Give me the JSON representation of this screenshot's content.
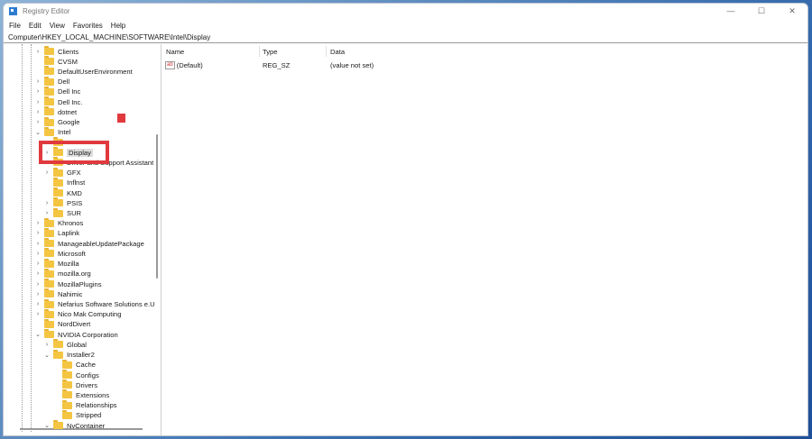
{
  "window": {
    "title": "Registry Editor",
    "controls": [
      "—",
      "☐",
      "✕"
    ]
  },
  "menu": [
    "File",
    "Edit",
    "View",
    "Favorites",
    "Help"
  ],
  "address": "Computer\\HKEY_LOCAL_MACHINE\\SOFTWARE\\Intel\\Display",
  "tree": [
    {
      "label": "Clients",
      "level": 1,
      "exp": ">"
    },
    {
      "label": "CVSM",
      "level": 1,
      "exp": ""
    },
    {
      "label": "DefaultUserEnvironment",
      "level": 1,
      "exp": ""
    },
    {
      "label": "Dell",
      "level": 1,
      "exp": ">"
    },
    {
      "label": "Dell Inc",
      "level": 1,
      "exp": ">"
    },
    {
      "label": "Dell Inc.",
      "level": 1,
      "exp": ">"
    },
    {
      "label": "dotnet",
      "level": 1,
      "exp": ">"
    },
    {
      "label": "Google",
      "level": 1,
      "exp": ">"
    },
    {
      "label": "Intel",
      "level": 1,
      "exp": "v"
    },
    {
      "label": "",
      "level": 2,
      "exp": ""
    },
    {
      "label": "Display",
      "level": 2,
      "exp": ">",
      "selected": true
    },
    {
      "label": "Driver and Support Assistant",
      "level": 2,
      "exp": ">"
    },
    {
      "label": "GFX",
      "level": 2,
      "exp": ">"
    },
    {
      "label": "Inflnst",
      "level": 2,
      "exp": ""
    },
    {
      "label": "KMD",
      "level": 2,
      "exp": ""
    },
    {
      "label": "PSIS",
      "level": 2,
      "exp": ">"
    },
    {
      "label": "SUR",
      "level": 2,
      "exp": ">"
    },
    {
      "label": "Khronos",
      "level": 1,
      "exp": ">"
    },
    {
      "label": "Laplink",
      "level": 1,
      "exp": ">"
    },
    {
      "label": "ManageableUpdatePackage",
      "level": 1,
      "exp": ">"
    },
    {
      "label": "Microsoft",
      "level": 1,
      "exp": ">"
    },
    {
      "label": "Mozilla",
      "level": 1,
      "exp": ">"
    },
    {
      "label": "mozilla.org",
      "level": 1,
      "exp": ">"
    },
    {
      "label": "MozillaPlugins",
      "level": 1,
      "exp": ">"
    },
    {
      "label": "Nahimic",
      "level": 1,
      "exp": ">"
    },
    {
      "label": "Nefarius Software Solutions e.U",
      "level": 1,
      "exp": ">"
    },
    {
      "label": "Nico Mak Computing",
      "level": 1,
      "exp": ">"
    },
    {
      "label": "NordDivert",
      "level": 1,
      "exp": ""
    },
    {
      "label": "NVIDIA Corporation",
      "level": 1,
      "exp": "v"
    },
    {
      "label": "Global",
      "level": 2,
      "exp": ">"
    },
    {
      "label": "Installer2",
      "level": 2,
      "exp": "v"
    },
    {
      "label": "Cache",
      "level": 3,
      "exp": ""
    },
    {
      "label": "Configs",
      "level": 3,
      "exp": ""
    },
    {
      "label": "Drivers",
      "level": 3,
      "exp": ""
    },
    {
      "label": "Extensions",
      "level": 3,
      "exp": ""
    },
    {
      "label": "Relationships",
      "level": 3,
      "exp": ""
    },
    {
      "label": "Stripped",
      "level": 3,
      "exp": ""
    },
    {
      "label": "NvContainer",
      "level": 2,
      "exp": "v"
    }
  ],
  "list": {
    "headers": {
      "name": "Name",
      "type": "Type",
      "data": "Data"
    },
    "rows": [
      {
        "name": "(Default)",
        "type": "REG_SZ",
        "data": "(value not set)"
      }
    ]
  },
  "colors": {
    "highlight": "#e0393e",
    "folder": "#f4c542"
  }
}
